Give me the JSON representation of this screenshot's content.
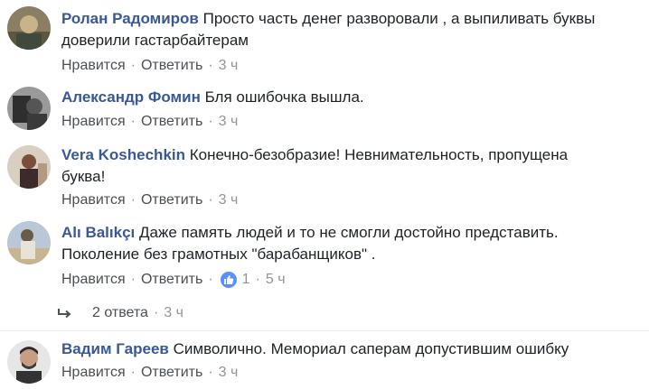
{
  "actions": {
    "like": "Нравится",
    "reply": "Ответить",
    "separator": "·"
  },
  "colors": {
    "author": "#385898",
    "action": "#4b4f56",
    "meta": "#90949c",
    "like_badge": "#5890ff"
  },
  "comments": [
    {
      "author": "Ролан Радомиров",
      "text_lines": [
        "Просто часть денег разворовали , а выпиливать буквы",
        "доверили гастарбайтерам"
      ],
      "time": "3 ч"
    },
    {
      "author": "Александр Фомин",
      "text_lines": [
        "Бля ошибочка вышла."
      ],
      "time": "3 ч"
    },
    {
      "author": "Vera Koshechkin",
      "text_lines": [
        "Конечно-безобразие! Невнимательность, пропущена",
        "буква!"
      ],
      "time": "3 ч"
    },
    {
      "author": "Alı Balıkçı",
      "text_lines": [
        "Даже память людей и то не смогли достойно представить.",
        "Поколение без грамотных \"барабанщиков\" ."
      ],
      "time": "5 ч",
      "like_icon": "thumbs-up-icon",
      "like_count": "1",
      "replies": {
        "label": "2 ответа",
        "time": "3 ч",
        "icon": "reply-arrow-icon"
      }
    },
    {
      "author": "Вадим Гареев",
      "text_lines": [
        "Символично. Мемориал саперам допустившим ошибку"
      ],
      "time": "3 ч"
    }
  ]
}
